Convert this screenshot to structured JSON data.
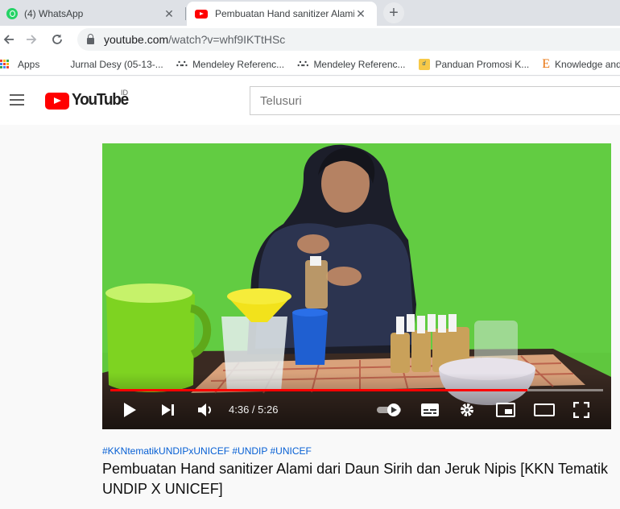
{
  "browser": {
    "tabs": [
      {
        "title": "(4) WhatsApp",
        "icon": "whatsapp-icon",
        "active": false,
        "close": "✕"
      },
      {
        "title": "Pembuatan Hand sanitizer Alami",
        "icon": "youtube-icon",
        "active": true,
        "close": "✕"
      }
    ],
    "new_tab": "+",
    "url_host": "youtube.com",
    "url_path": "/watch?v=whf9IKTtHSc",
    "bookmarks": [
      {
        "label": "Apps",
        "icon": "apps-grid-icon"
      },
      {
        "label": "Jurnal Desy (05-13-...",
        "icon": "none"
      },
      {
        "label": "Mendeley Referenc...",
        "icon": "mendeley-icon"
      },
      {
        "label": "Mendeley Referenc...",
        "icon": "mendeley-icon"
      },
      {
        "label": "Panduan Promosi K...",
        "icon": "dok-icon"
      },
      {
        "label": "Knowledge and",
        "icon": "knowledge-e-icon"
      }
    ]
  },
  "youtube": {
    "logo_text": "YouTube",
    "region": "ID",
    "search_placeholder": "Telusuri",
    "player": {
      "current_time": "4:36 / 5:26",
      "progress": 0.846
    },
    "hashtags": "#KKNtematikUNDIPxUNICEF #UNDIP #UNICEF",
    "title": "Pembuatan Hand sanitizer Alami dari Daun Sirih dan Jeruk Nipis [KKN Tematik UNDIP X UNICEF]"
  },
  "colors": {
    "youtube_red": "#ff0000",
    "link_blue": "#065fd4",
    "video_background_green": "#5fc73e"
  }
}
